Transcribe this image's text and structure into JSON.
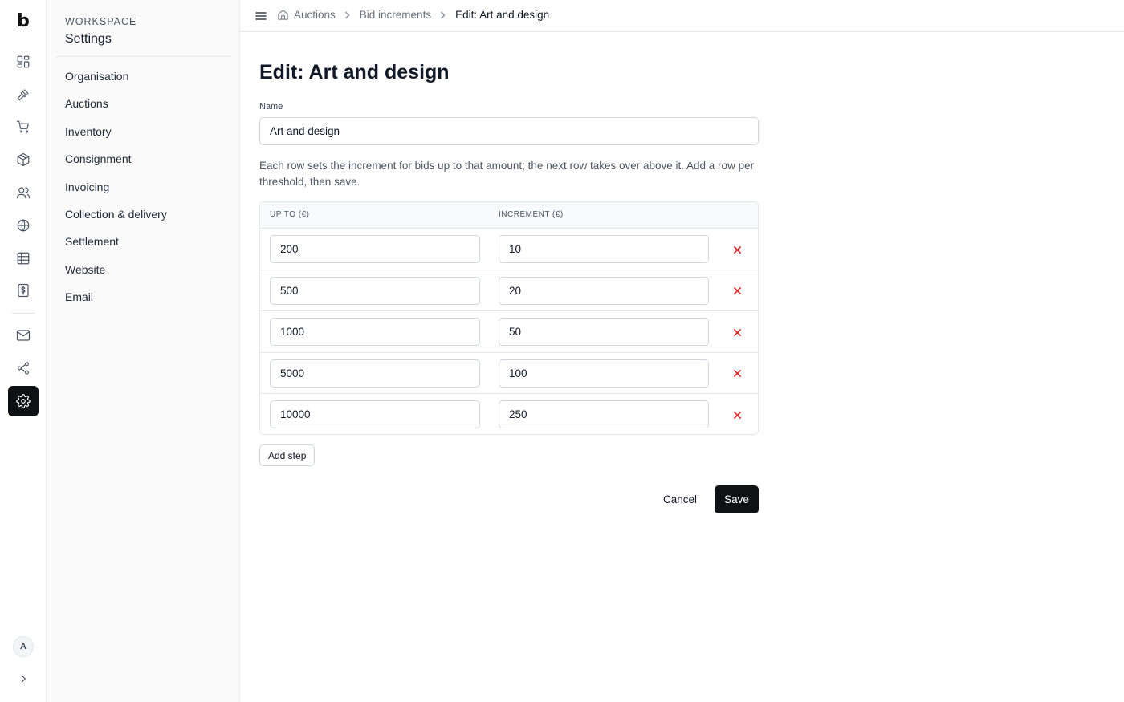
{
  "app": {
    "logo": "b"
  },
  "rail": {
    "icons": [
      "dashboard-icon",
      "gavel-icon",
      "cart-icon",
      "package-icon",
      "users-icon",
      "globe-icon",
      "table-icon",
      "invoice-icon",
      "mail-icon",
      "share-icon",
      "settings-icon"
    ],
    "active": "settings-icon",
    "avatar_initial": "A"
  },
  "panel": {
    "eyebrow": "WORKSPACE",
    "title": "Settings",
    "items": [
      {
        "label": "Organisation"
      },
      {
        "label": "Auctions"
      },
      {
        "label": "Inventory"
      },
      {
        "label": "Consignment"
      },
      {
        "label": "Invoicing"
      },
      {
        "label": "Collection & delivery"
      },
      {
        "label": "Settlement"
      },
      {
        "label": "Website"
      },
      {
        "label": "Email"
      }
    ]
  },
  "breadcrumb": [
    {
      "label": "Auctions"
    },
    {
      "label": "Bid increments"
    },
    {
      "label": "Edit: Art and design"
    }
  ],
  "page": {
    "title": "Edit: Art and design",
    "name_label": "Name",
    "name_value": "Art and design",
    "help": "Each row sets the increment for bids up to that amount; the next row takes over above it. Add a row per threshold, then save."
  },
  "table": {
    "headers": {
      "up_to": "UP TO (€)",
      "increment": "INCREMENT (€)"
    },
    "rows": [
      {
        "up_to": "200",
        "increment": "10"
      },
      {
        "up_to": "500",
        "increment": "20"
      },
      {
        "up_to": "1000",
        "increment": "50"
      },
      {
        "up_to": "5000",
        "increment": "100"
      },
      {
        "up_to": "10000",
        "increment": "250"
      }
    ]
  },
  "actions": {
    "add_step": "Add step",
    "cancel": "Cancel",
    "save": "Save"
  },
  "colors": {
    "primary": "#0f1115",
    "danger": "#dc2626",
    "border": "#e5e7eb"
  }
}
